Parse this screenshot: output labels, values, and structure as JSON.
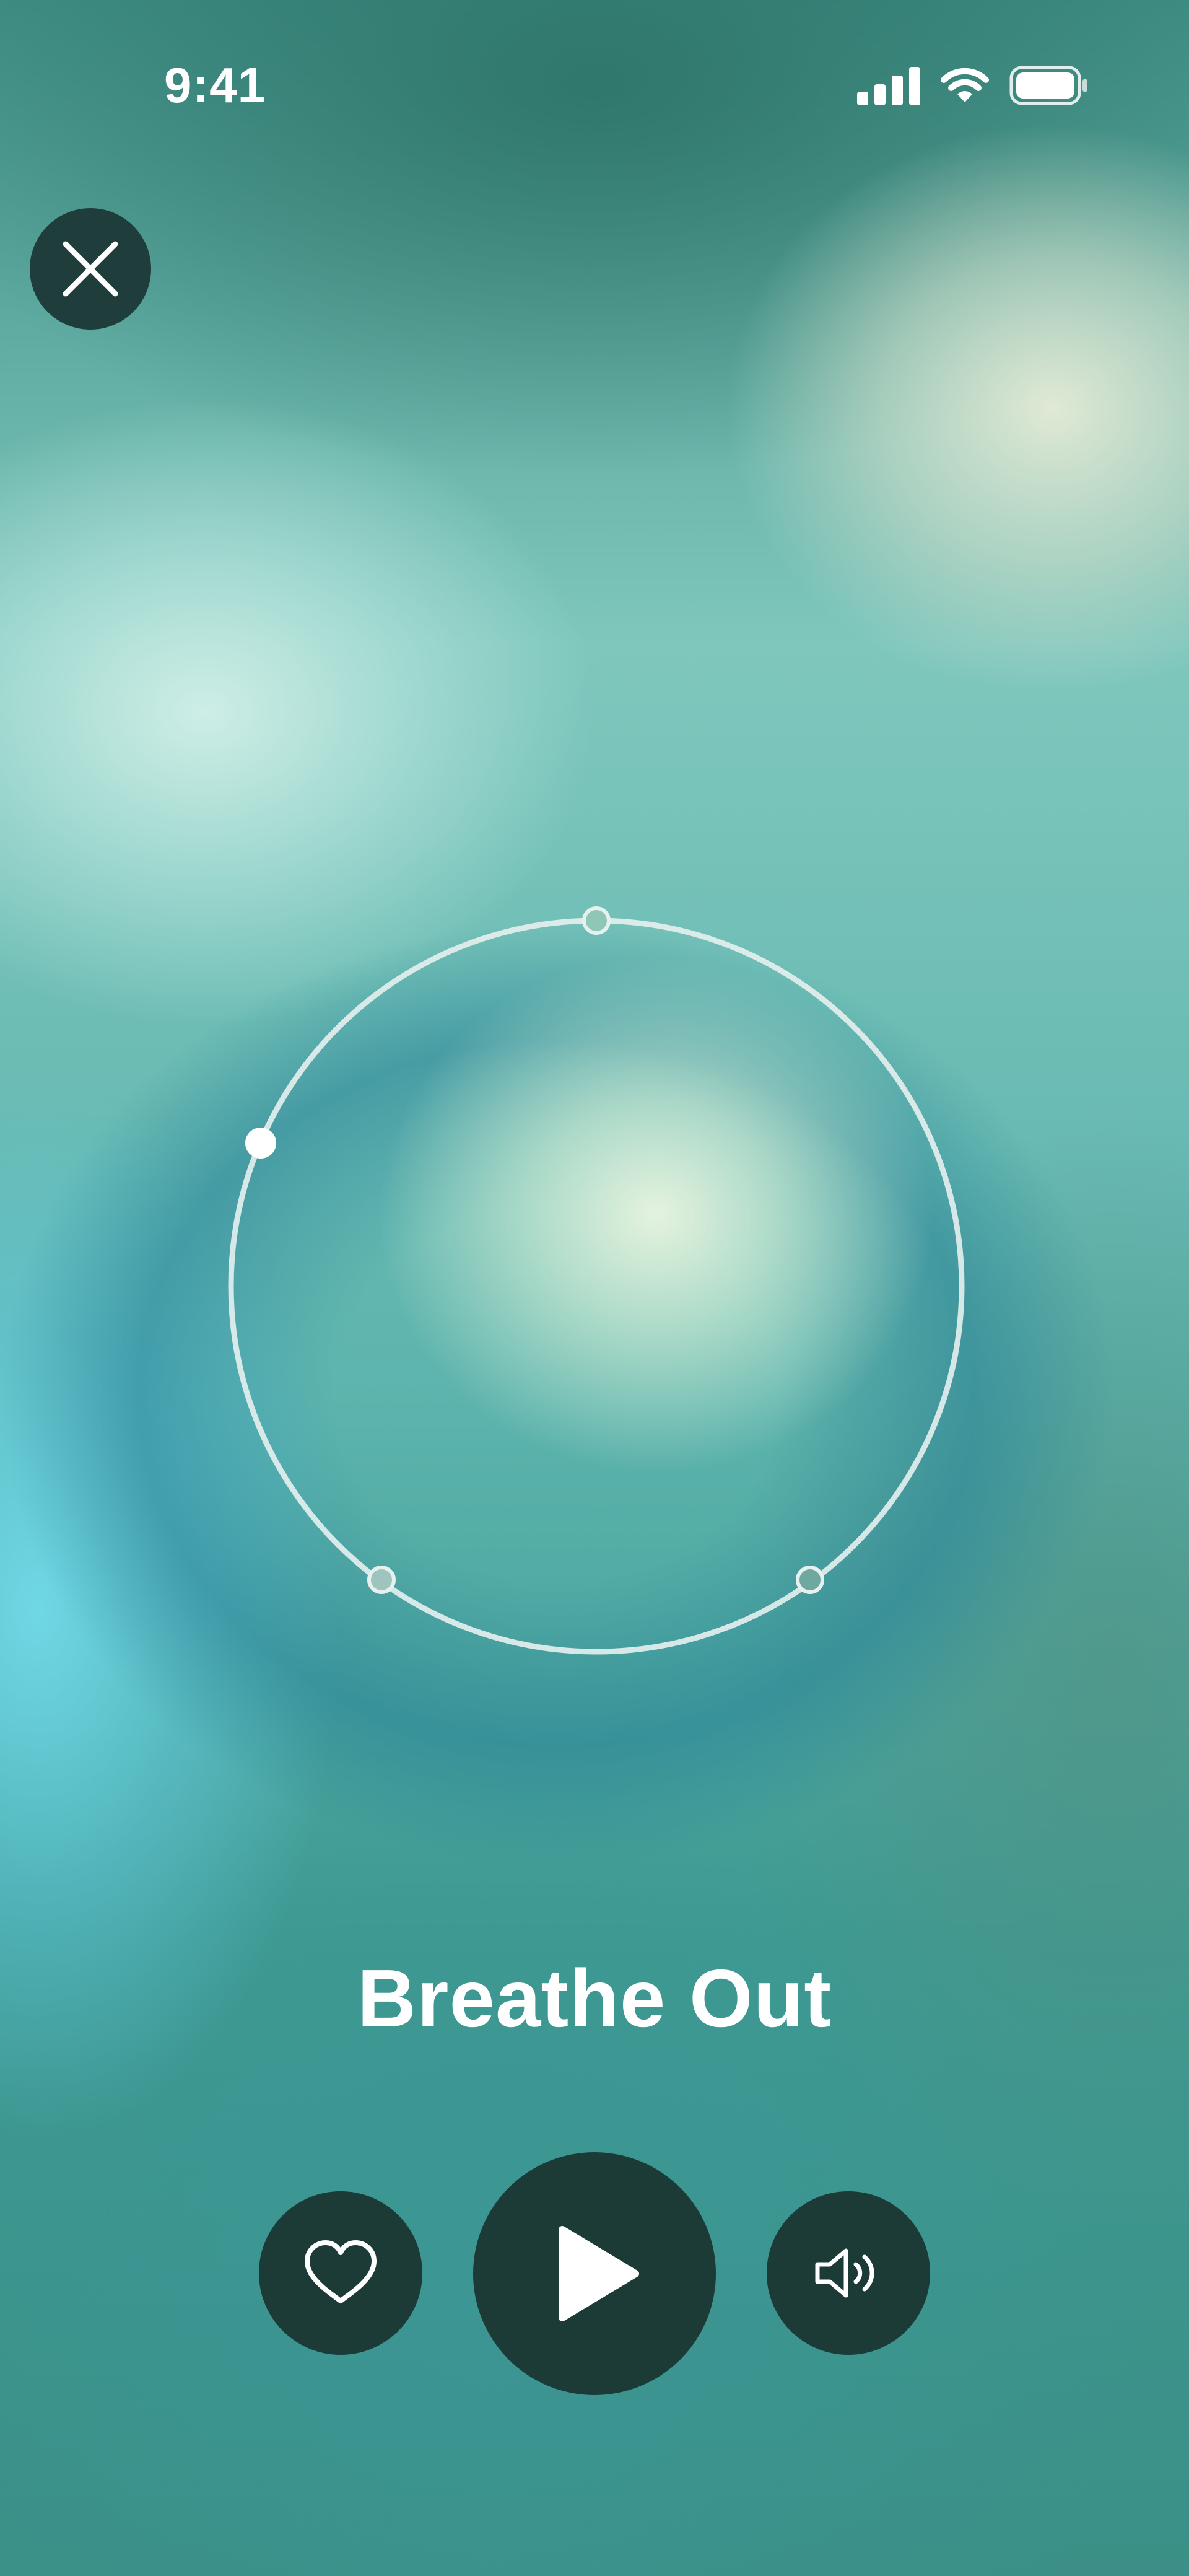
{
  "status_bar": {
    "time": "9:41",
    "icons": [
      "cellular-signal-icon",
      "wifi-icon",
      "battery-icon"
    ]
  },
  "header": {
    "close_icon": "close-icon"
  },
  "breathing": {
    "phase_label": "Breathe Out",
    "ring_markers": [
      "top-marker",
      "left-active-marker",
      "bottom-left-marker",
      "bottom-right-marker"
    ]
  },
  "controls": {
    "favorite_icon": "heart-icon",
    "play_icon": "play-icon",
    "sound_icon": "speaker-icon"
  },
  "colors": {
    "control_background": "#1c3b37",
    "text": "#ffffff",
    "ring": "#e6f0ee"
  }
}
